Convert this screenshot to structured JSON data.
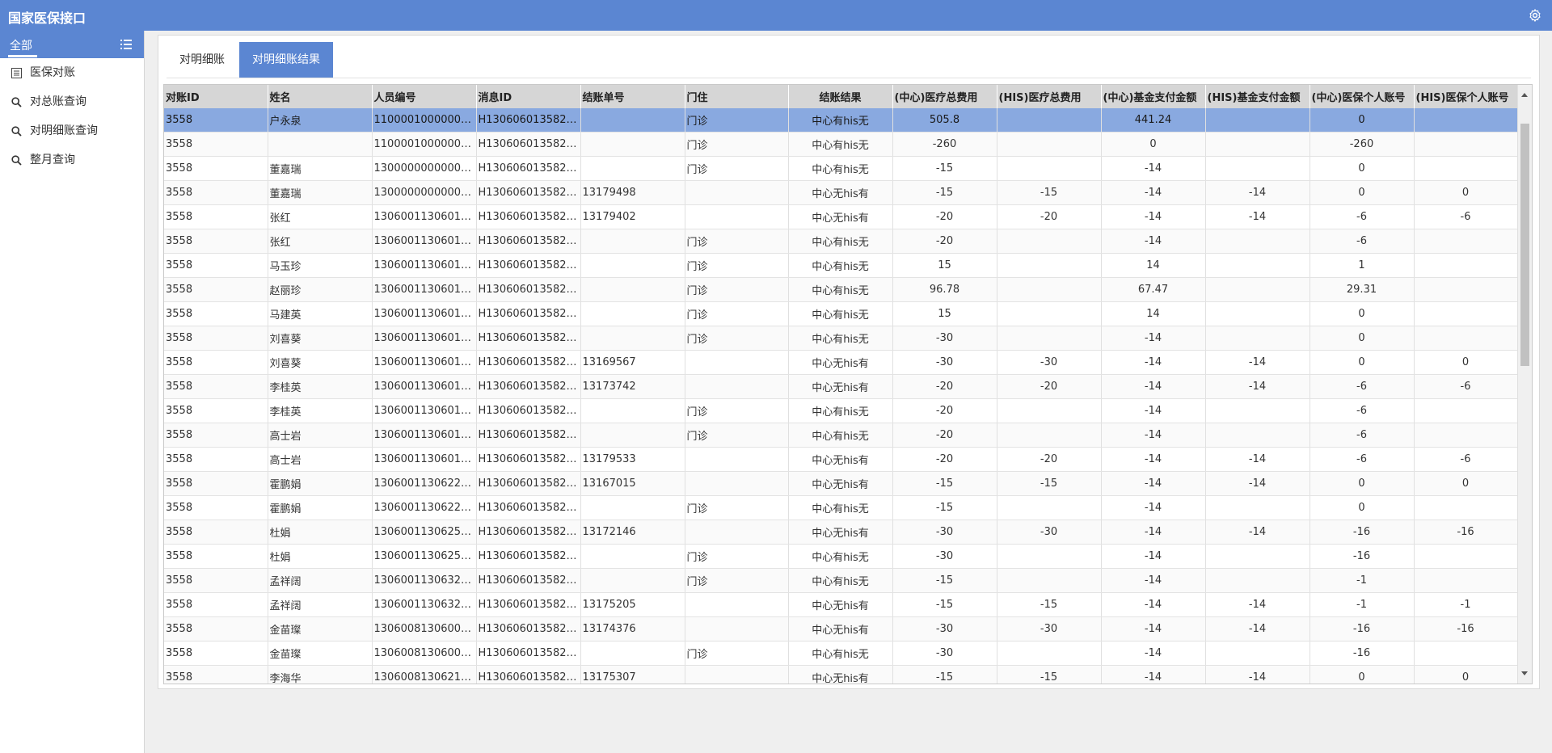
{
  "app": {
    "title": "国家医保接口",
    "settings_icon": "gear-icon"
  },
  "sidebar": {
    "header_label": "全部",
    "menu_icon": "hamburger-icon",
    "items": [
      {
        "label": "医保对账",
        "icon": "list-doc-icon"
      },
      {
        "label": "对总账查询",
        "icon": "search-icon"
      },
      {
        "label": "对明细账查询",
        "icon": "search-icon"
      },
      {
        "label": "整月查询",
        "icon": "search-icon"
      }
    ]
  },
  "tabs": [
    {
      "label": "对明细账",
      "active": false
    },
    {
      "label": "对明细账结果",
      "active": true
    }
  ],
  "table": {
    "columns": [
      "对账ID",
      "姓名",
      "人员编号",
      "消息ID",
      "结账单号",
      "门住",
      "结账结果",
      "(中心)医疗总费用",
      "(HIS)医疗总费用",
      "(中心)基金支付金额",
      "(HIS)基金支付金额",
      "(中心)医保个人账号",
      "(HIS)医保个人账号"
    ],
    "rows": [
      [
        "3558",
        "户永泉",
        "11000010000000...",
        "H1306060135820...",
        "",
        "门诊",
        "中心有his无",
        "505.8",
        "",
        "441.24",
        "",
        "0",
        ""
      ],
      [
        "3558",
        "",
        "11000010000000...",
        "H1306060135820...",
        "",
        "门诊",
        "中心有his无",
        "-260",
        "",
        "0",
        "",
        "-260",
        ""
      ],
      [
        "3558",
        "董嘉瑞",
        "13000000000000...",
        "H1306060135820...",
        "",
        "门诊",
        "中心有his无",
        "-15",
        "",
        "-14",
        "",
        "0",
        ""
      ],
      [
        "3558",
        "董嘉瑞",
        "13000000000000...",
        "H1306060135820...",
        "13179498",
        "",
        "中心无his有",
        "-15",
        "-15",
        "-14",
        "-14",
        "0",
        "0"
      ],
      [
        "3558",
        "张红",
        "13060011306010...",
        "H1306060135820...",
        "13179402",
        "",
        "中心无his有",
        "-20",
        "-20",
        "-14",
        "-14",
        "-6",
        "-6"
      ],
      [
        "3558",
        "张红",
        "13060011306010...",
        "H1306060135820...",
        "",
        "门诊",
        "中心有his无",
        "-20",
        "",
        "-14",
        "",
        "-6",
        ""
      ],
      [
        "3558",
        "马玉珍",
        "13060011306010...",
        "H1306060135820...",
        "",
        "门诊",
        "中心有his无",
        "15",
        "",
        "14",
        "",
        "1",
        ""
      ],
      [
        "3558",
        "赵丽珍",
        "13060011306010...",
        "H1306060135820...",
        "",
        "门诊",
        "中心有his无",
        "96.78",
        "",
        "67.47",
        "",
        "29.31",
        ""
      ],
      [
        "3558",
        "马建英",
        "13060011306011...",
        "H1306060135820...",
        "",
        "门诊",
        "中心有his无",
        "15",
        "",
        "14",
        "",
        "0",
        ""
      ],
      [
        "3558",
        "刘喜葵",
        "13060011306013...",
        "H1306060135820...",
        "",
        "门诊",
        "中心有his无",
        "-30",
        "",
        "-14",
        "",
        "0",
        ""
      ],
      [
        "3558",
        "刘喜葵",
        "13060011306013...",
        "H1306060135820...",
        "13169567",
        "",
        "中心无his有",
        "-30",
        "-30",
        "-14",
        "-14",
        "0",
        "0"
      ],
      [
        "3558",
        "李桂英",
        "13060011306013...",
        "H1306060135820...",
        "13173742",
        "",
        "中心无his有",
        "-20",
        "-20",
        "-14",
        "-14",
        "-6",
        "-6"
      ],
      [
        "3558",
        "李桂英",
        "13060011306013...",
        "H1306060135820...",
        "",
        "门诊",
        "中心有his无",
        "-20",
        "",
        "-14",
        "",
        "-6",
        ""
      ],
      [
        "3558",
        "高士岩",
        "13060011306019...",
        "H1306060135820...",
        "",
        "门诊",
        "中心有his无",
        "-20",
        "",
        "-14",
        "",
        "-6",
        ""
      ],
      [
        "3558",
        "高士岩",
        "13060011306019...",
        "H1306060135820...",
        "13179533",
        "",
        "中心无his有",
        "-20",
        "-20",
        "-14",
        "-14",
        "-6",
        "-6"
      ],
      [
        "3558",
        "霍鹏娟",
        "13060011306221...",
        "H1306060135820...",
        "13167015",
        "",
        "中心无his有",
        "-15",
        "-15",
        "-14",
        "-14",
        "0",
        "0"
      ],
      [
        "3558",
        "霍鹏娟",
        "13060011306221...",
        "H1306060135820...",
        "",
        "门诊",
        "中心有his无",
        "-15",
        "",
        "-14",
        "",
        "0",
        ""
      ],
      [
        "3558",
        "杜娟",
        "13060011306251...",
        "H1306060135820...",
        "13172146",
        "",
        "中心无his有",
        "-30",
        "-30",
        "-14",
        "-14",
        "-16",
        "-16"
      ],
      [
        "3558",
        "杜娟",
        "13060011306251...",
        "H1306060135820...",
        "",
        "门诊",
        "中心有his无",
        "-30",
        "",
        "-14",
        "",
        "-16",
        ""
      ],
      [
        "3558",
        "孟祥阔",
        "13060011306321...",
        "H1306060135820...",
        "",
        "门诊",
        "中心有his无",
        "-15",
        "",
        "-14",
        "",
        "-1",
        ""
      ],
      [
        "3558",
        "孟祥阔",
        "13060011306321...",
        "H1306060135820...",
        "13175205",
        "",
        "中心无his有",
        "-15",
        "-15",
        "-14",
        "-14",
        "-1",
        "-1"
      ],
      [
        "3558",
        "金苗璨",
        "13060081306000...",
        "H1306060135820...",
        "13174376",
        "",
        "中心无his有",
        "-30",
        "-30",
        "-14",
        "-14",
        "-16",
        "-16"
      ],
      [
        "3558",
        "金苗璨",
        "13060081306000...",
        "H1306060135820...",
        "",
        "门诊",
        "中心有his无",
        "-30",
        "",
        "-14",
        "",
        "-16",
        ""
      ],
      [
        "3558",
        "李海华",
        "13060081306211...",
        "H1306060135820...",
        "13175307",
        "",
        "中心无his有",
        "-15",
        "-15",
        "-14",
        "-14",
        "0",
        "0"
      ]
    ],
    "selected_row": 0
  },
  "colors": {
    "accent": "#5b86d2",
    "selected_row": "#89a9e0",
    "header_bg": "#d6d6d6"
  }
}
